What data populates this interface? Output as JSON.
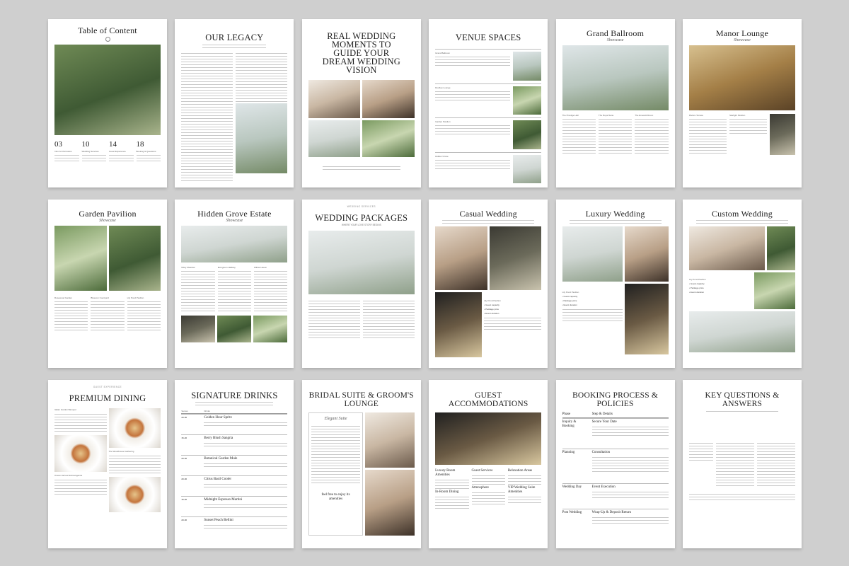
{
  "pages": {
    "toc": {
      "title": "Table of Content",
      "items": [
        {
          "num": "03",
          "label": "Intro & Information"
        },
        {
          "num": "10",
          "label": "Wedding Services"
        },
        {
          "num": "14",
          "label": "Guest Experience"
        },
        {
          "num": "18",
          "label": "Booking & Questions"
        }
      ]
    },
    "legacy": {
      "title": "OUR LEGACY"
    },
    "moments": {
      "title": "REAL WEDDING MOMENTS TO GUIDE YOUR DREAM WEDDING VISION"
    },
    "venue": {
      "title": "VENUE SPACES",
      "spaces": [
        "Grand Ballroom",
        "Rooftop Lounge",
        "Garden Pavilion",
        "Hidden Grove"
      ]
    },
    "ballroom": {
      "title": "Grand Ballroom",
      "script": "Showcase",
      "rooms": [
        {
          "name": "The Prestige Hall",
          "capacity": "Capacity",
          "cost": "Cost"
        },
        {
          "name": "The Royal Suite",
          "capacity": "Capacity",
          "cost": "Cost"
        },
        {
          "name": "The Emerald Room",
          "capacity": "Capacity",
          "cost": "Cost"
        }
      ]
    },
    "manor": {
      "title": "Manor Lounge",
      "script": "Showcase",
      "rooms": [
        {
          "name": "Rivière Terrace",
          "capacity": "Capacity",
          "cost": "Cost"
        },
        {
          "name": "Starlight Pavilion",
          "capacity": "Capacity",
          "cost": "Cost"
        }
      ]
    },
    "garden": {
      "title": "Garden Pavilion",
      "script": "Showcase",
      "areas": [
        "Rosewood Garden",
        "Blossom Courtyard",
        "Lily Pond Pavilion"
      ]
    },
    "grove": {
      "title": "Hidden Grove Estate",
      "script": "Showcase",
      "areas": [
        "Misty Meadow",
        "Evergreen Hallway",
        "Willow Haven"
      ]
    },
    "packages": {
      "kicker": "WEDDING SERVICES",
      "title": "WEDDING PACKAGES",
      "sub": "WHERE YOUR LOVE STORY BEGINS"
    },
    "casual": {
      "title": "Casual Wedding",
      "venue": "Lily Pond Pavilion",
      "bullets": [
        "Guest capacity",
        "Package price",
        "Event duration"
      ]
    },
    "luxury": {
      "title": "Luxury Wedding",
      "venue": "Lily Pond Pavilion",
      "bullets": [
        "Guest capacity",
        "Package price",
        "Event duration"
      ]
    },
    "custom": {
      "title": "Custom Wedding",
      "venue": "Lily Pond Pavilion",
      "bullets": [
        "Guest capacity",
        "Package price",
        "Event duration"
      ]
    },
    "dining": {
      "kicker": "GUEST EXPERIENCE",
      "title": "PREMIUM DINING",
      "menus": [
        "Italian Garden Banquet",
        "The Woodhouse Gathering",
        "Ocean Harvest Extravaganza"
      ]
    },
    "drinks": {
      "title": "SIGNATURE DRINKS",
      "header": [
        "Serves",
        "Drinks"
      ],
      "rows": [
        {
          "serves": "20-30",
          "name": "Golden Hour Spritz"
        },
        {
          "serves": "15-20",
          "name": "Berry Blush Sangria"
        },
        {
          "serves": "20-30",
          "name": "Botanical Garden Mule"
        },
        {
          "serves": "20-30",
          "name": "Citrus Basil Cooler"
        },
        {
          "serves": "15-20",
          "name": "Midnight Espresso Martini"
        },
        {
          "serves": "20-30",
          "name": "Sunset Peach Bellini"
        }
      ]
    },
    "bridal": {
      "title": "BRIDAL SUITE & GROOM'S LOUNGE",
      "script": "Elegant Suite",
      "note": "feel free to enjoy its amenities"
    },
    "guest": {
      "title": "GUEST ACCOMMODATIONS",
      "cols": [
        "Luxury Room Amenities",
        "Guest Services",
        "Relaxation Areas"
      ],
      "extra": [
        "Atmosphere",
        "In-Room Dining",
        "VIP Wedding Suite Amenities"
      ]
    },
    "booking": {
      "title": "BOOKING PROCESS & POLICIES",
      "header": [
        "Phase",
        "Step & Details"
      ],
      "rows": [
        {
          "phase": "Inquiry & Booking",
          "step": "Secure Your Date"
        },
        {
          "phase": "Planning",
          "step": "Consultation"
        },
        {
          "phase": "Wedding Day",
          "step": "Event Execution"
        },
        {
          "phase": "Post Wedding",
          "step": "Wrap-Up & Deposit Return"
        }
      ]
    },
    "questions": {
      "title": "KEY QUESTIONS & ANSWERS"
    }
  }
}
